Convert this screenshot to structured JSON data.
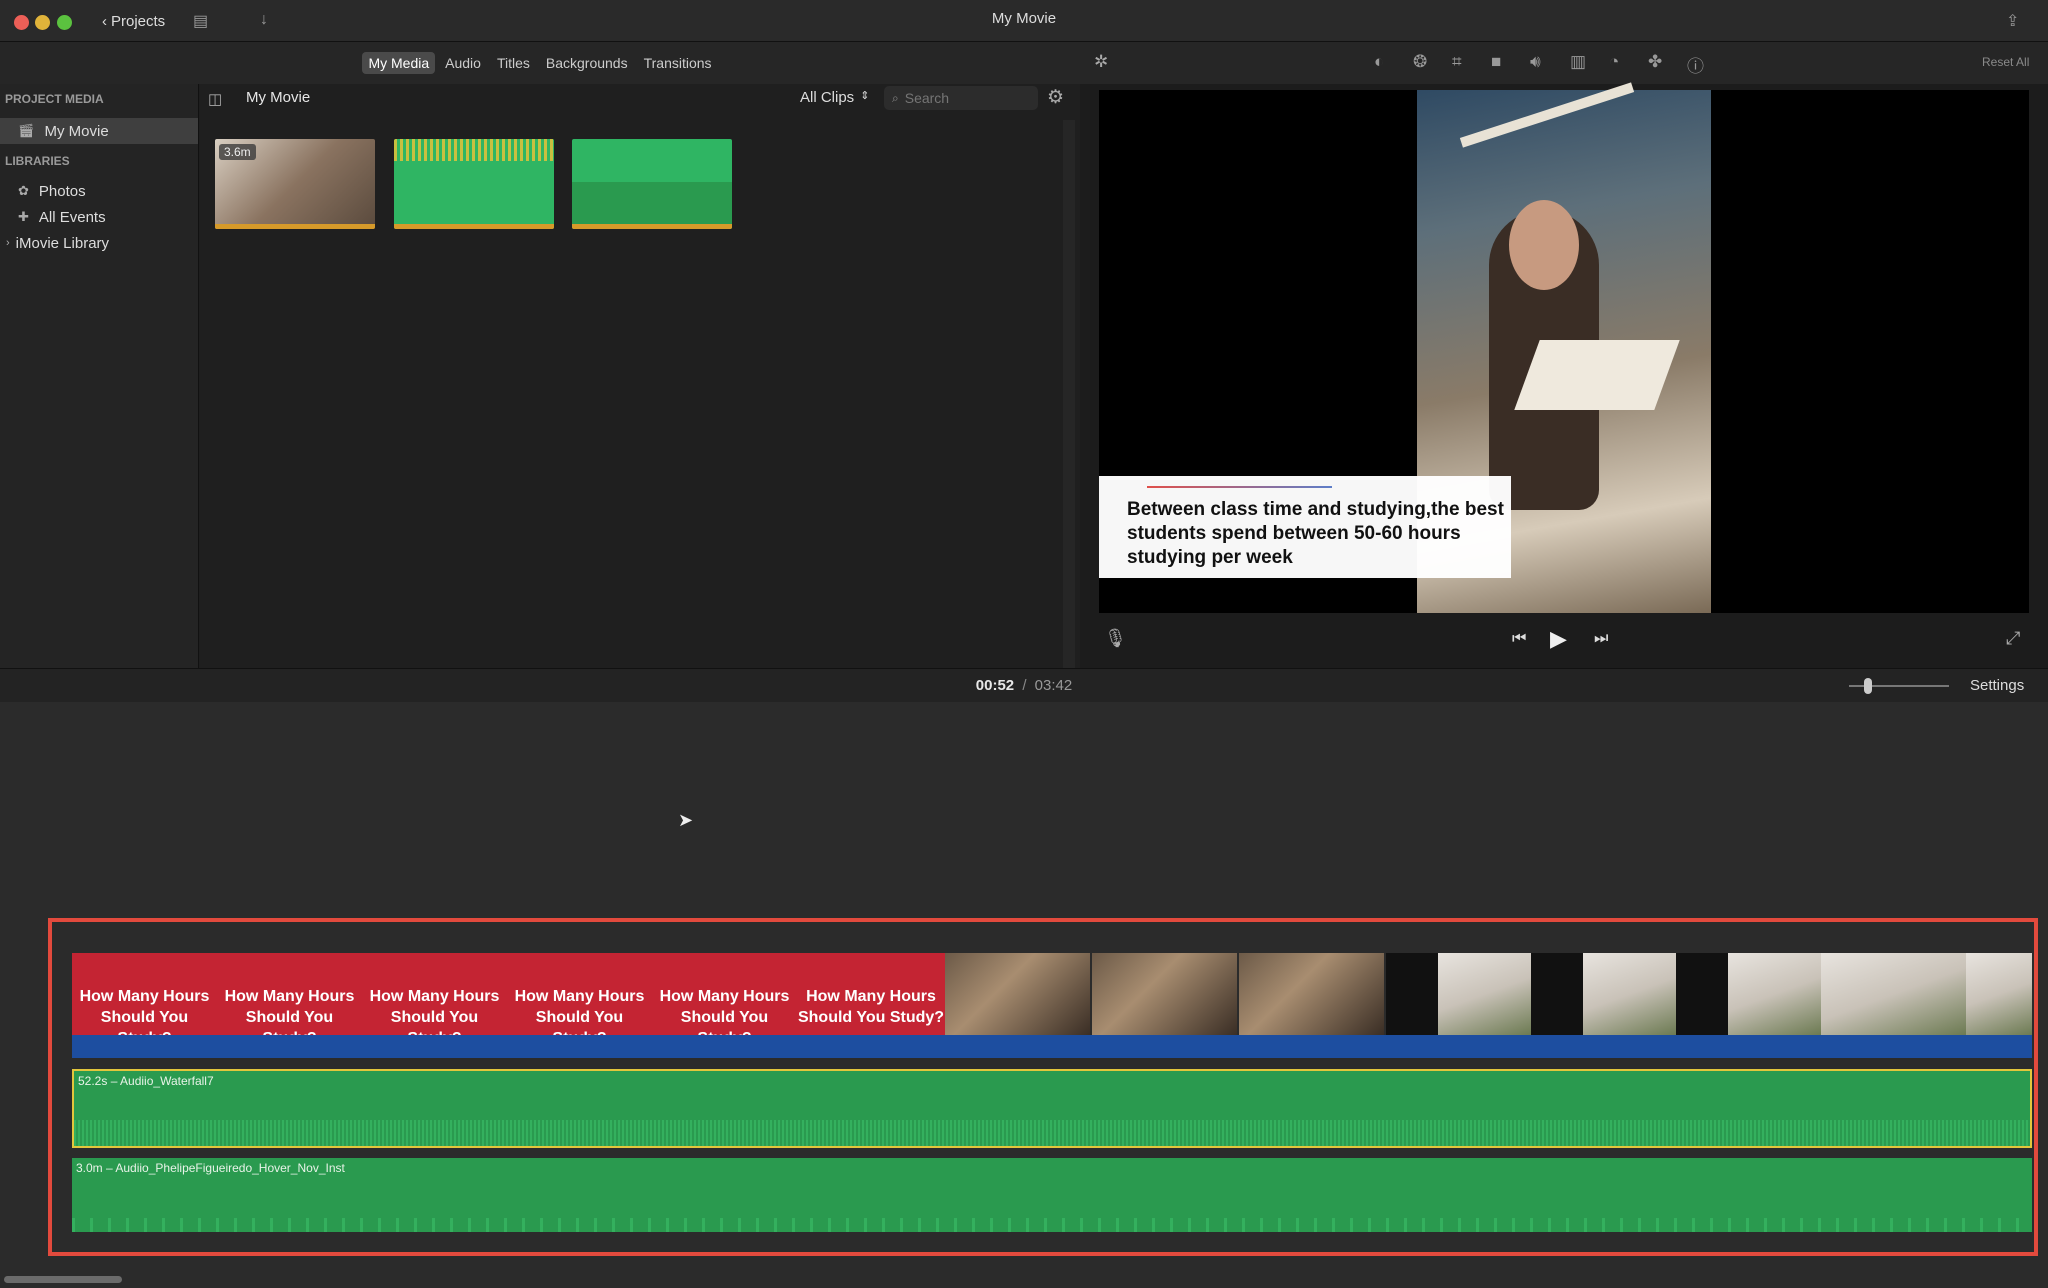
{
  "window": {
    "title": "My Movie",
    "projects_label": "Projects"
  },
  "browser_tabs": [
    {
      "label": "My Media",
      "active": true
    },
    {
      "label": "Audio",
      "active": false
    },
    {
      "label": "Titles",
      "active": false
    },
    {
      "label": "Backgrounds",
      "active": false
    },
    {
      "label": "Transitions",
      "active": false
    }
  ],
  "sidebar": {
    "project_media_header": "PROJECT MEDIA",
    "project_item": "My Movie",
    "libraries_header": "LIBRARIES",
    "library_items": [
      "Photos",
      "All Events"
    ],
    "library_root": "iMovie Library"
  },
  "media": {
    "title": "My Movie",
    "filter": "All Clips",
    "search_placeholder": "Search",
    "clip_duration_badge": "3.6m"
  },
  "viewer": {
    "reset_label": "Reset All",
    "caption": "Between class time and studying,the best students spend between 50-60 hours studying per week"
  },
  "timebar": {
    "current_time": "00:52",
    "separator": "/",
    "total_time": "03:42",
    "settings_label": "Settings"
  },
  "timeline": {
    "title_frames": [
      "How Many Hours Should You Study?",
      "How Many Hours Should You Study?",
      "How Many Hours Should You Study?",
      "How Many Hours Should You Study?",
      "How Many Hours Should You Study?",
      "How Many Hours Should You Study?"
    ],
    "audio_tracks": [
      {
        "label": "52.2s – Audiio_Waterfall7"
      },
      {
        "label": "3.0m – Audiio_PhelipeFigueiredo_Hover_Nov_Inst"
      }
    ]
  },
  "colors": {
    "highlight": "#e24a3d",
    "audio_green": "#2a9a4f",
    "title_red": "#c42433",
    "video_blue": "#1d4ea0"
  }
}
